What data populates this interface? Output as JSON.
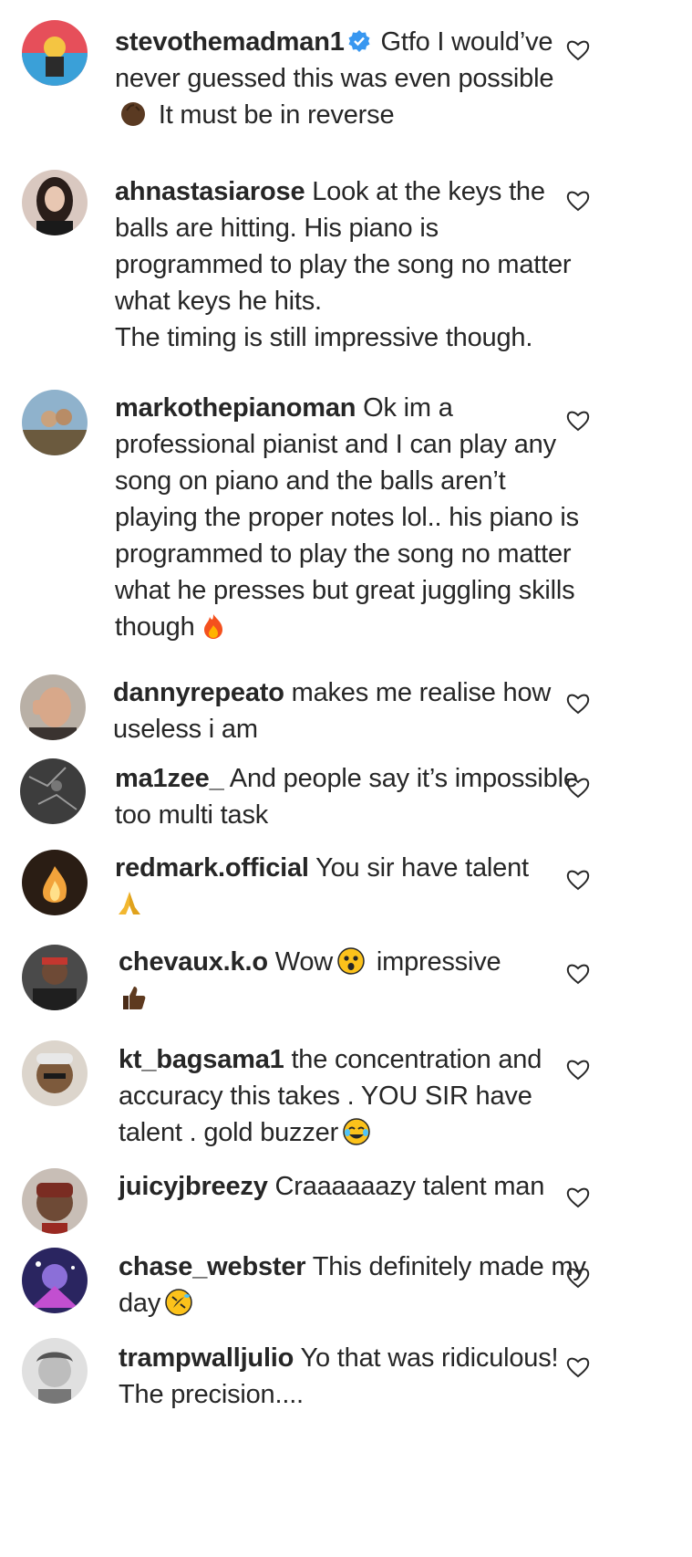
{
  "comments": [
    {
      "username": "stevothemadman1",
      "verified": true,
      "text_before": "Gtfo I would’ve never guessed this was even possible",
      "emoji": "clapping-hands-emoji",
      "text_after": "It must be in reverse",
      "avatar": {
        "bg": "#e64f5a",
        "fg": "#f4c542"
      }
    },
    {
      "username": "ahnastasiarose",
      "text_before": "Look at the keys the balls are hitting. His piano is programmed to play the song no matter what keys he hits.\nThe timing is still impressive though.",
      "avatar": {
        "bg": "#d9c8c0",
        "fg": "#2a1e1a"
      }
    },
    {
      "username": "markothepianoman",
      "text_before": "Ok im a professional pianist and I can play any song on piano and the balls aren’t playing the proper notes lol.. his piano is programmed to play the song no matter what he presses but great juggling skills though",
      "emoji": "fire-emoji",
      "avatar": {
        "bg": "#8fb2cc",
        "fg": "#6b5a3e"
      }
    },
    {
      "username": "dannyrepeato",
      "text_before": "makes me realise how useless i am",
      "avatar": {
        "bg": "#b9b0a6",
        "fg": "#3a3330"
      }
    },
    {
      "username": "ma1zee_",
      "text_before": "And people say it’s impossible too multi task",
      "avatar": {
        "bg": "#3d3d3d",
        "fg": "#9a9a9a"
      }
    },
    {
      "username": "redmark.official",
      "text_before": "You sir have talent",
      "emoji": "folded-hands-emoji",
      "avatar": {
        "bg": "#2a1d14",
        "fg": "#f2a33b"
      }
    },
    {
      "username": "chevaux.k.o",
      "text_before": "Wow",
      "emoji": "astonished-face-emoji",
      "text_after": "impressive",
      "emoji2": "thumbs-up-emoji",
      "avatar": {
        "bg": "#4a4a4a",
        "fg": "#c4372f"
      }
    },
    {
      "username": "kt_bagsama1",
      "text_before": "the concentration and accuracy this takes . YOU SIR have talent . gold buzzer",
      "emoji": "tears-of-joy-emoji",
      "avatar": {
        "bg": "#7d5a3c",
        "fg": "#dcd5cc"
      }
    },
    {
      "username": "juicyjbreezy",
      "text_before": "Craaaaaazy talent man",
      "avatar": {
        "bg": "#c8beb6",
        "fg": "#7a2c22"
      }
    },
    {
      "username": "chase_webster",
      "text_before": "This definitely made my day",
      "emoji": "rolling-laughing-emoji",
      "avatar": {
        "bg": "#2a2560",
        "fg": "#8b6fd8"
      }
    },
    {
      "username": "trampwalljulio",
      "text_before": "Yo that was ridiculous! The precision....",
      "avatar": {
        "bg": "#e0e0e0",
        "fg": "#555555"
      }
    }
  ],
  "colors": {
    "text": "#262626",
    "heart": "#262626",
    "verified": "#3897f0"
  }
}
